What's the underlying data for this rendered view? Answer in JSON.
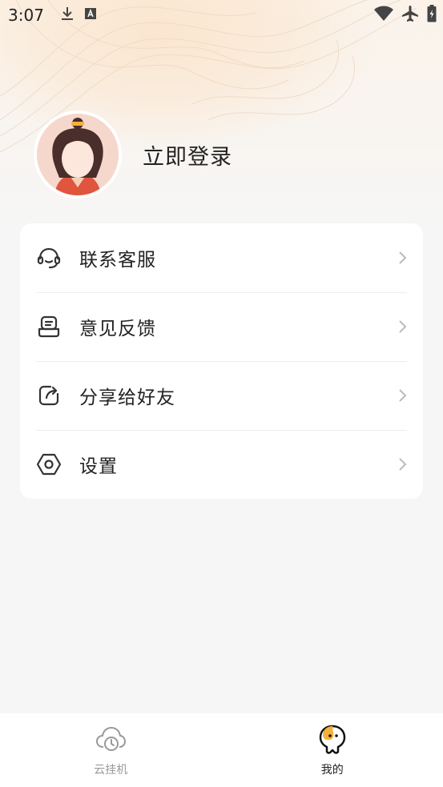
{
  "status_bar": {
    "time": "3:07"
  },
  "profile": {
    "login_label": "立即登录"
  },
  "menu": {
    "items": [
      {
        "label": "联系客服",
        "icon": "headset-icon"
      },
      {
        "label": "意见反馈",
        "icon": "feedback-icon"
      },
      {
        "label": "分享给好友",
        "icon": "share-icon"
      },
      {
        "label": "设置",
        "icon": "settings-icon"
      }
    ]
  },
  "tabbar": {
    "tabs": [
      {
        "label": "云挂机",
        "icon": "cloud-clock-icon",
        "active": false
      },
      {
        "label": "我的",
        "icon": "mascot-icon",
        "active": true
      }
    ]
  },
  "colors": {
    "accent": "#f5b13a",
    "background": "#f6f6f6",
    "card": "#ffffff"
  }
}
